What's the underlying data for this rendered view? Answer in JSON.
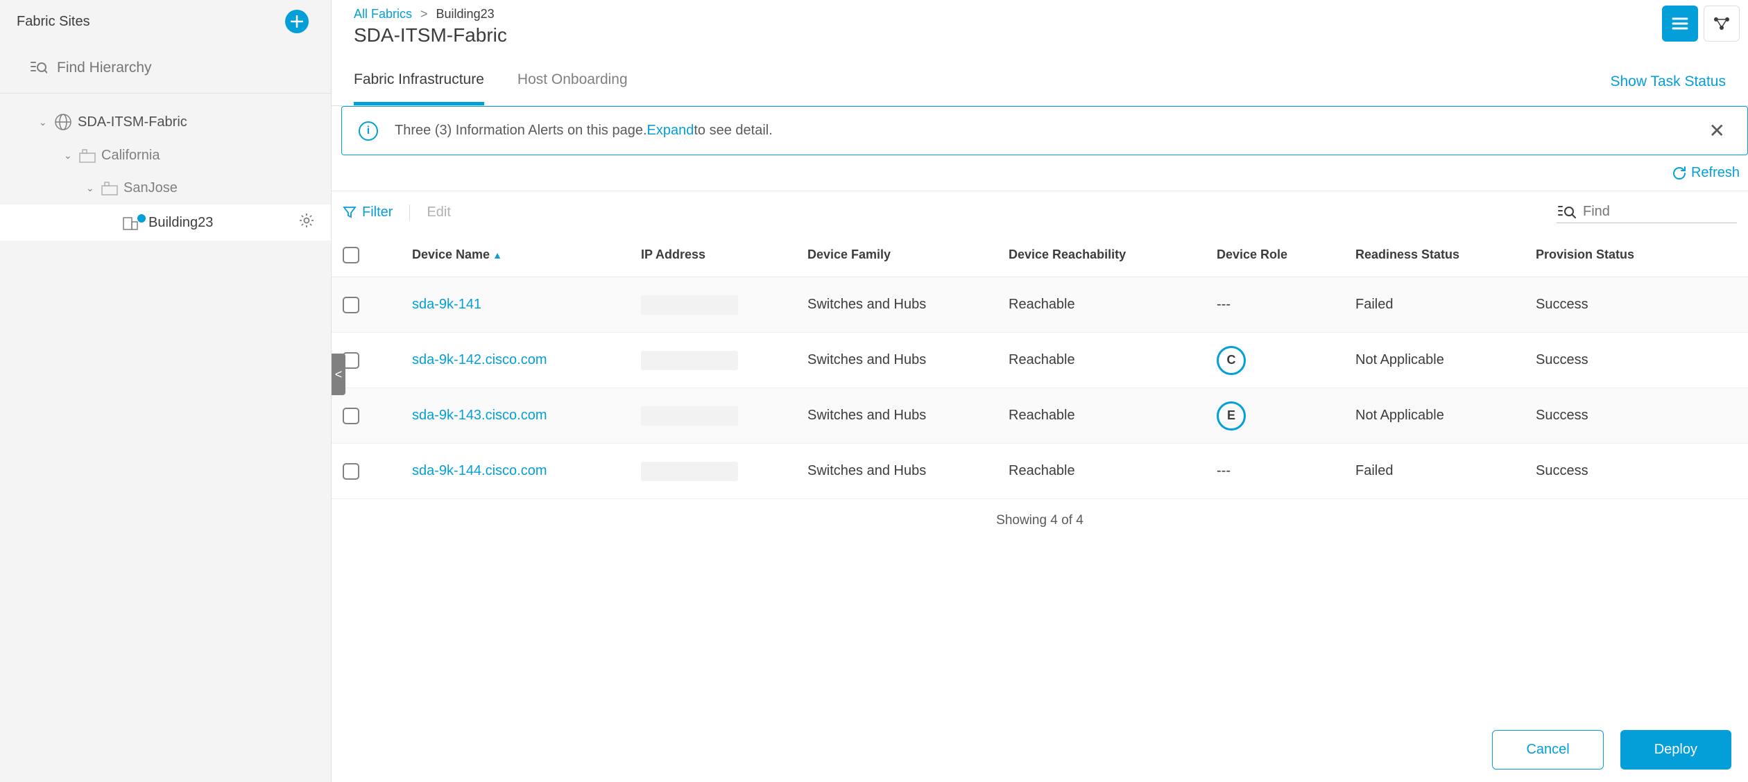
{
  "sidebar": {
    "title": "Fabric Sites",
    "search_placeholder": "Find Hierarchy",
    "tree": {
      "root": "SDA-ITSM-Fabric",
      "l1": "California",
      "l2": "SanJose",
      "l3": "Building23"
    }
  },
  "breadcrumbs": {
    "root": "All Fabrics",
    "current": "Building23"
  },
  "page_title": "SDA-ITSM-Fabric",
  "tabs": {
    "t0": "Fabric Infrastructure",
    "t1": "Host Onboarding"
  },
  "show_task": "Show Task Status",
  "alert": {
    "text_pre": "Three (3) Information Alerts on this page. ",
    "expand": "Expand",
    "text_post": " to see detail."
  },
  "refresh": "Refresh",
  "toolbar": {
    "filter": "Filter",
    "edit": "Edit",
    "find_placeholder": "Find"
  },
  "columns": {
    "c0": "Device Name",
    "c1": "IP Address",
    "c2": "Device Family",
    "c3": "Device Reachability",
    "c4": "Device Role",
    "c5": "Readiness Status",
    "c6": "Provision Status"
  },
  "rows": [
    {
      "name": "sda-9k-141",
      "family": "Switches and Hubs",
      "reach": "Reachable",
      "role": "---",
      "readiness": "Failed",
      "provision": "Success"
    },
    {
      "name": "sda-9k-142.cisco.com",
      "family": "Switches and Hubs",
      "reach": "Reachable",
      "role_badge": "C",
      "readiness": "Not Applicable",
      "provision": "Success"
    },
    {
      "name": "sda-9k-143.cisco.com",
      "family": "Switches and Hubs",
      "reach": "Reachable",
      "role_badge": "E",
      "readiness": "Not Applicable",
      "provision": "Success"
    },
    {
      "name": "sda-9k-144.cisco.com",
      "family": "Switches and Hubs",
      "reach": "Reachable",
      "role": "---",
      "readiness": "Failed",
      "provision": "Success"
    }
  ],
  "table_footer": "Showing 4 of 4",
  "footer": {
    "cancel": "Cancel",
    "deploy": "Deploy"
  }
}
